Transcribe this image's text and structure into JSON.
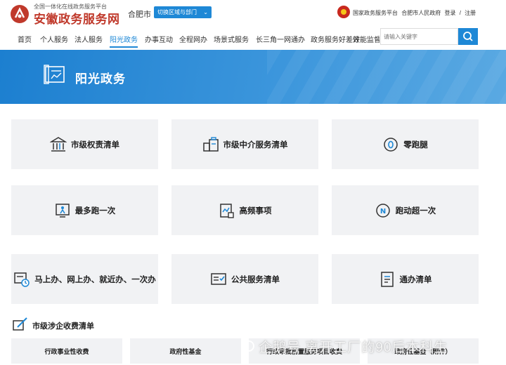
{
  "header": {
    "brand_small": "全国一体化在线政务服务平台",
    "brand_name": "安徽政务服务网",
    "city": "合肥市",
    "switch_label": "切换区域与部门",
    "top_links": [
      "国家政务服务平台",
      "合肥市人民政府",
      "登录",
      "/",
      "注册"
    ]
  },
  "nav": {
    "items": [
      "首页",
      "个人服务",
      "法人服务",
      "阳光政务",
      "办事互动",
      "全程网办",
      "场景式服务",
      "长三角一网通办",
      "政务服务好差评",
      "效能监督"
    ],
    "active": "阳光政务"
  },
  "search": {
    "placeholder": "请输入关键字"
  },
  "banner": {
    "title": "阳光政务"
  },
  "cards": [
    {
      "label": "市级权责清单",
      "icon": "building-icon"
    },
    {
      "label": "市级中介服务清单",
      "icon": "agency-icon"
    },
    {
      "label": "零跑腿",
      "icon": "zero-run-icon"
    },
    {
      "label": "最多跑一次",
      "icon": "run-once-icon"
    },
    {
      "label": "高频事项",
      "icon": "high-frequency-icon"
    },
    {
      "label": "跑动超一次",
      "icon": "run-over-once-icon"
    },
    {
      "label": "马上办、网上办、就近办、一次办",
      "icon": "four-ways-icon"
    },
    {
      "label": "公共服务清单",
      "icon": "checklist-icon"
    },
    {
      "label": "通办清单",
      "icon": "document-icon"
    }
  ],
  "fees_section": {
    "title": "市级涉企收费清单",
    "tabs": [
      "行政事业性收费",
      "政府性基金",
      "行政审批前置服务项目收费",
      "政府性基金（附件）"
    ]
  },
  "watermark": {
    "text": "企鹅号 离开工厂的90后本科生"
  },
  "colors": {
    "accent": "#1e88d6",
    "brand_red": "#c0392b",
    "card_bg": "#f1f2f4"
  }
}
